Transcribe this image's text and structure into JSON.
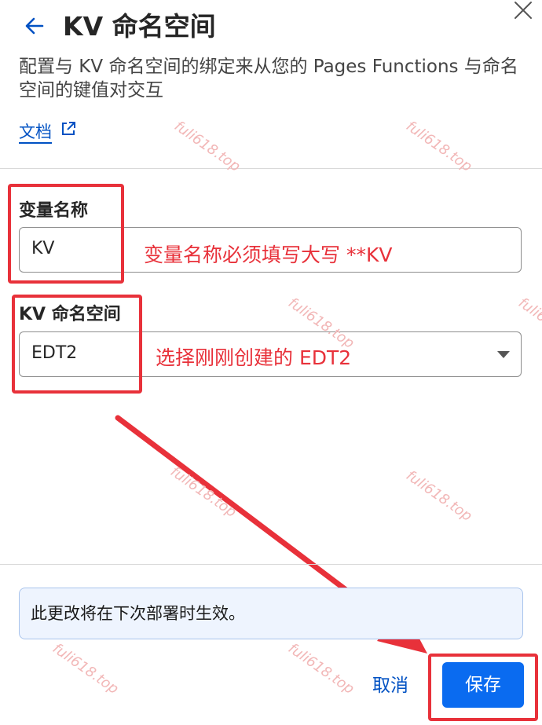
{
  "header": {
    "title": "KV 命名空间",
    "description": "配置与 KV 命名空间的绑定来从您的 Pages Functions 与命名空间的键值对交互",
    "doc_link": "文档",
    "icons": {
      "back": "arrow-left-icon",
      "close": "close-icon",
      "external": "external-link-icon"
    }
  },
  "form": {
    "variable_name_label": "变量名称",
    "variable_name_value": "KV",
    "namespace_label": "KV 命名空间",
    "namespace_value": "EDT2"
  },
  "annotations": {
    "variable_note": "变量名称必须填写大写 **KV",
    "namespace_note": "选择刚刚创建的 EDT2"
  },
  "info_banner": {
    "text": "此更改将在下次部署时生效。"
  },
  "footer": {
    "cancel_label": "取消",
    "save_label": "保存"
  },
  "watermark": {
    "text": "fuli618.top"
  },
  "colors": {
    "accent": "#0a6bf0",
    "link": "#0051c3",
    "annotation": "#e8313a",
    "banner_bg": "#eef4fe"
  }
}
